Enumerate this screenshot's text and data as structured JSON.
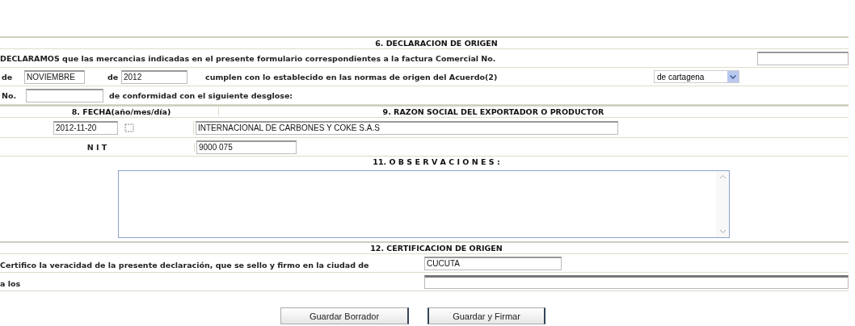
{
  "declaration": {
    "title": "6. DECLARACION DE ORIGEN",
    "statement": "DECLARAMOS que las mercancias indicadas en el presente formulario correspondientes a la factura Comercial No.",
    "month_label": "de",
    "month": "NOVIEMBRE",
    "year_label": "de",
    "year": "2012",
    "compliance_text": "cumplen con lo establecido en las normas de origen del Acuerdo(2)",
    "agreement": "de cartagena",
    "number_label": "No.",
    "breakdown_text": "de conformidad con el siguiente desglose:"
  },
  "date_section": {
    "title": "8. FECHA(año/mes/día)",
    "date": "2012-11-20"
  },
  "exporter_section": {
    "title": "9. RAZON SOCIAL DEL EXPORTADOR O PRODUCTOR",
    "company_name": "INTERNACIONAL DE CARBONES Y COKE S.A.S",
    "nit_label": "N I T",
    "nit": "9000 075"
  },
  "observations": {
    "title": "11. O B S E R V A C I O N E S :"
  },
  "certification": {
    "title": "12. CERTIFICACION DE ORIGEN",
    "statement": "Certifico la veracidad de la presente declaración, que se sello y firmo en la ciudad de",
    "city": "CUCUTA",
    "date_label": "a los"
  },
  "buttons": [
    "Guardar Borrador",
    "Guardar y Firmar"
  ]
}
